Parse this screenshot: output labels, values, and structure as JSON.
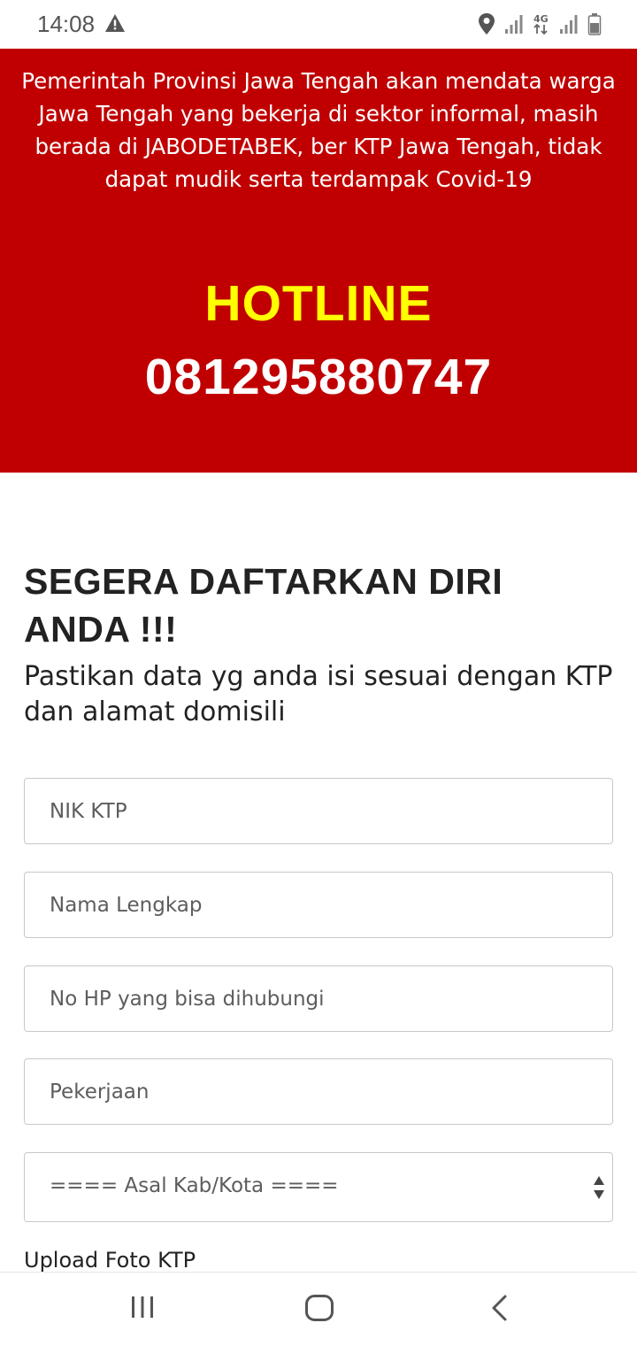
{
  "status_bar": {
    "time": "14:08",
    "icons": [
      "warning-icon",
      "location-icon",
      "signal-icon",
      "4g-icon",
      "signal-icon",
      "battery-icon"
    ]
  },
  "banner": {
    "message": "Pemerintah Provinsi Jawa Tengah akan mendata warga Jawa Tengah yang bekerja di sektor informal, masih berada di JABODETABEK, ber KTP Jawa Tengah, tidak dapat mudik serta terdampak Covid-19",
    "hotline_label": "HOTLINE",
    "hotline_number": "081295880747",
    "background_color": "#c00000",
    "hotline_color": "#ffff00"
  },
  "form": {
    "heading": "SEGERA DAFTARKAN DIRI ANDA !!!",
    "subheading": "Pastikan data yg anda isi sesuai dengan KTP dan alamat domisili",
    "fields": {
      "nik": {
        "placeholder": "NIK KTP",
        "value": ""
      },
      "nama": {
        "placeholder": "Nama Lengkap",
        "value": ""
      },
      "no_hp": {
        "placeholder": "No HP yang bisa dihubungi",
        "value": ""
      },
      "pekerjaan": {
        "placeholder": "Pekerjaan",
        "value": ""
      }
    },
    "asal_select": {
      "selected": "==== Asal Kab/Kota ===="
    },
    "upload_label": "Upload Foto KTP"
  },
  "nav_bar": {
    "buttons": [
      "recent-apps-icon",
      "home-icon",
      "back-icon"
    ]
  }
}
